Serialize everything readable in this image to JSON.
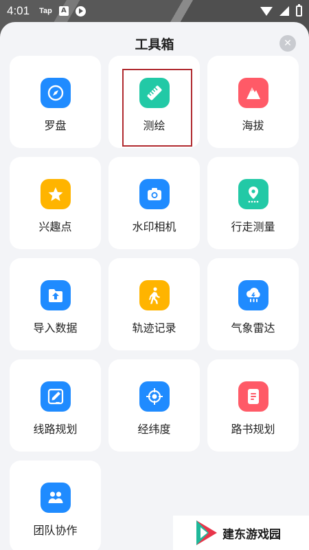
{
  "status_bar": {
    "time": "4:01",
    "chip": "Tap",
    "square_glyph": "A"
  },
  "sheet": {
    "title": "工具箱",
    "close_glyph": "✕"
  },
  "tools": [
    {
      "label": "罗盘",
      "icon": "compass-icon",
      "color": "#1f8bff"
    },
    {
      "label": "测绘",
      "icon": "ruler-icon",
      "color": "#22c9a6",
      "selected": true
    },
    {
      "label": "海拔",
      "icon": "mountain-icon",
      "color": "#ff5a67"
    },
    {
      "label": "兴趣点",
      "icon": "star-icon",
      "color": "#ffb400"
    },
    {
      "label": "水印相机",
      "icon": "camera-icon",
      "color": "#1f8bff"
    },
    {
      "label": "行走测量",
      "icon": "location-pin-icon",
      "color": "#22c9a6"
    },
    {
      "label": "导入数据",
      "icon": "upload-folder-icon",
      "color": "#1f8bff"
    },
    {
      "label": "轨迹记录",
      "icon": "walking-person-icon",
      "color": "#ffb400"
    },
    {
      "label": "气象雷达",
      "icon": "rain-cloud-icon",
      "color": "#1f8bff"
    },
    {
      "label": "线路规划",
      "icon": "edit-pen-icon",
      "color": "#1f8bff"
    },
    {
      "label": "经纬度",
      "icon": "crosshair-icon",
      "color": "#1f8bff"
    },
    {
      "label": "路书规划",
      "icon": "document-icon",
      "color": "#ff5a67"
    },
    {
      "label": "团队协作",
      "icon": "team-icon",
      "color": "#1f8bff"
    }
  ],
  "watermark": {
    "text": "建东游戏园"
  }
}
